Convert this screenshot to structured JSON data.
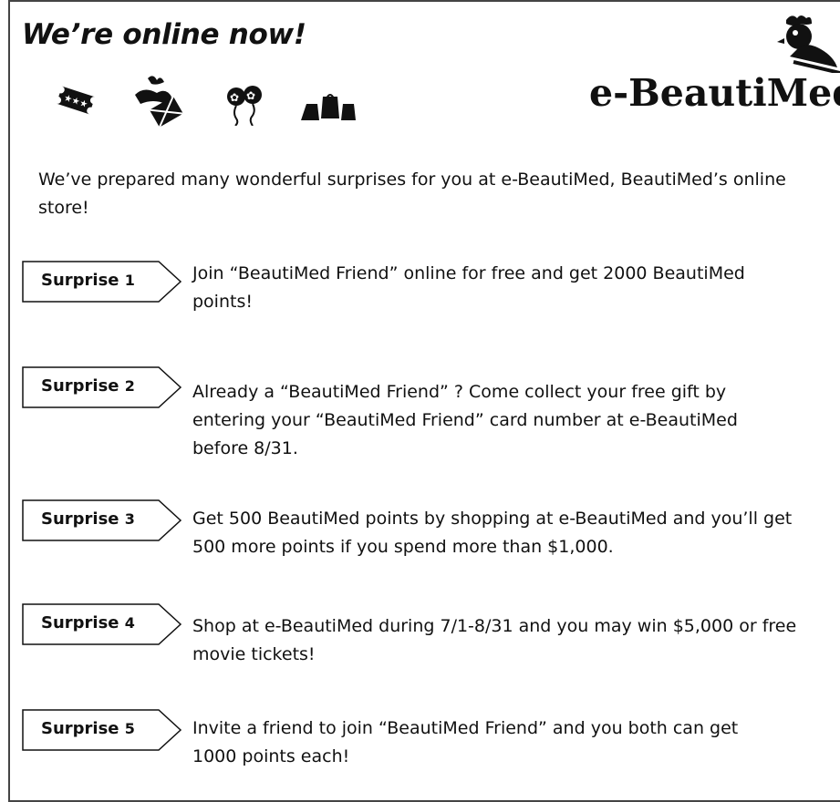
{
  "header": {
    "headline": "We’re online now!",
    "logo_text": "e-BeautiMed"
  },
  "icons": [
    "ticket-icon",
    "gift-box-icon",
    "balloons-icon",
    "shopping-bags-icon",
    "rooster-logo-icon"
  ],
  "intro": "We’ve prepared many wonderful surprises for you at e-BeautiMed, BeautiMed’s online store!",
  "surprises": [
    {
      "label": "Surprise",
      "number": "1",
      "text": "Join “BeautiMed Friend” online for free and get 2000 BeautiMed points!"
    },
    {
      "label": "Surprise",
      "number": "2",
      "text": "Already a “BeautiMed Friend” ? Come collect your free gift by entering your “BeautiMed Friend” card number at e-BeautiMed before 8/31."
    },
    {
      "label": "Surprise",
      "number": "3",
      "text": "Get 500 BeautiMed points by shopping at e-BeautiMed and you’ll get 500 more points if you spend more than $1,000."
    },
    {
      "label": "Surprise",
      "number": "4",
      "text": "Shop at e-BeautiMed during 7/1-8/31 and you may win $5,000 or free movie tickets!"
    },
    {
      "label": "Surprise",
      "number": "5",
      "text": "Invite a friend to join “BeautiMed Friend” and you both can get 1000 points each!"
    }
  ]
}
